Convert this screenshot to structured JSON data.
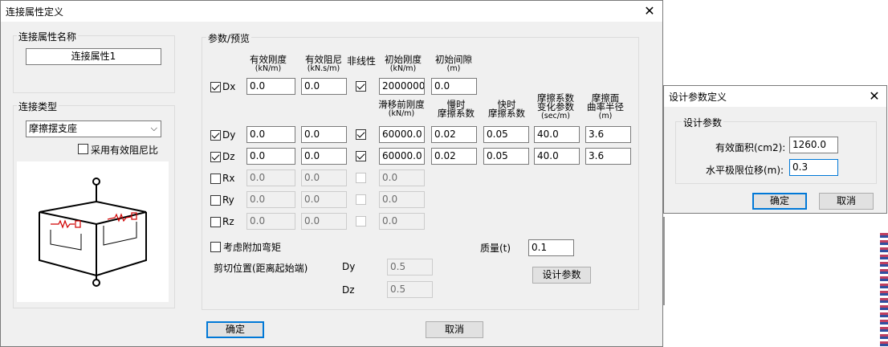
{
  "main": {
    "title": "连接属性定义",
    "name_group": "连接属性名称",
    "name_value": "连接属性1",
    "type_group": "连接类型",
    "type_value": "摩擦摆支座",
    "use_damping": "采用有效阻尼比",
    "params_group": "参数/预览",
    "headers": {
      "eff_stiff": "有效刚度",
      "eff_stiff_unit": "(kN/m)",
      "eff_damp": "有效阻尼",
      "eff_damp_unit": "(kN.s/m)",
      "nonlinear": "非线性",
      "init_stiff": "初始刚度",
      "init_stiff_unit": "(kN/m)",
      "init_gap": "初始间隙",
      "init_gap_unit": "(m)",
      "slip_stiff": "滑移前刚度",
      "slip_stiff_unit": "(kN/m)",
      "slow_fric_1": "慢时",
      "slow_fric_2": "摩擦系数",
      "fast_fric_1": "快时",
      "fast_fric_2": "摩擦系数",
      "fric_rate_1": "摩擦系数",
      "fric_rate_2": "变化参数",
      "fric_rate_unit": "(sec/m)",
      "radius_1": "摩擦面",
      "radius_2": "曲率半径",
      "radius_unit": "(m)"
    },
    "rows": {
      "dx": {
        "label": "Dx",
        "eff_stiff": "0.0",
        "eff_damp": "0.0",
        "init_stiff": "2000000.0",
        "init_gap": "0.0"
      },
      "dy": {
        "label": "Dy",
        "eff_stiff": "0.0",
        "eff_damp": "0.0",
        "slip_stiff": "60000.0",
        "slow_fric": "0.02",
        "fast_fric": "0.05",
        "fric_rate": "40.0",
        "radius": "3.6"
      },
      "dz": {
        "label": "Dz",
        "eff_stiff": "0.0",
        "eff_damp": "0.0",
        "slip_stiff": "60000.0",
        "slow_fric": "0.02",
        "fast_fric": "0.05",
        "fric_rate": "40.0",
        "radius": "3.6"
      },
      "rx": {
        "label": "Rx",
        "eff_stiff": "0.0",
        "eff_damp": "0.0",
        "third": "0.0"
      },
      "ry": {
        "label": "Ry",
        "eff_stiff": "0.0",
        "eff_damp": "0.0",
        "third": "0.0"
      },
      "rz": {
        "label": "Rz",
        "eff_stiff": "0.0",
        "eff_damp": "0.0",
        "third": "0.0"
      }
    },
    "extra_moment": "考虑附加弯矩",
    "mass_label": "质量(t)",
    "mass_value": "0.1",
    "shear_pos_label": "剪切位置(距离起始端)",
    "shear_dy_label": "Dy",
    "shear_dy_value": "0.5",
    "shear_dz_label": "Dz",
    "shear_dz_value": "0.5",
    "design_params_button": "设计参数",
    "ok": "确定",
    "cancel": "取消"
  },
  "design": {
    "title": "设计参数定义",
    "group": "设计参数",
    "area_label": "有效面积(cm2):",
    "area_value": "1260.0",
    "disp_label": "水平极限位移(m):",
    "disp_value": "0.3",
    "ok": "确定",
    "cancel": "取消"
  },
  "colors": {
    "accent": "#0078d7",
    "dialog_bg": "#f0f0f0",
    "spring_red": "#d00000"
  }
}
